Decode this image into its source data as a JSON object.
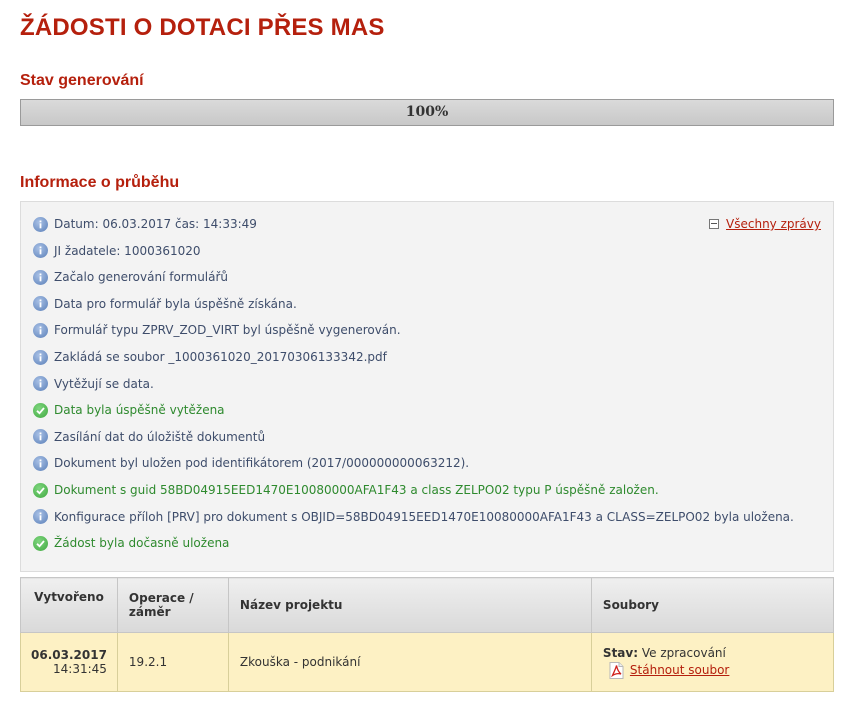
{
  "page_title": "ŽÁDOSTI O DOTACI PŘES MAS",
  "progress": {
    "heading": "Stav generování",
    "label": "100%",
    "value": 1.0
  },
  "log": {
    "heading": "Informace o průběhu",
    "all_messages_label": "Všechny zprávy",
    "entries": [
      {
        "type": "info",
        "icon": "info-icon",
        "text": "Datum: 06.03.2017 čas: 14:33:49"
      },
      {
        "type": "info",
        "icon": "info-icon",
        "text": "JI žadatele: 1000361020"
      },
      {
        "type": "info",
        "icon": "info-icon",
        "text": "Začalo generování formulářů"
      },
      {
        "type": "info",
        "icon": "info-icon",
        "text": "Data pro formulář byla úspěšně získána."
      },
      {
        "type": "info",
        "icon": "info-icon",
        "text": "Formulář typu ZPRV_ZOD_VIRT byl úspěšně vygenerován."
      },
      {
        "type": "info",
        "icon": "info-icon",
        "text": "Zakládá se soubor _1000361020_20170306133342.pdf"
      },
      {
        "type": "info",
        "icon": "info-icon",
        "text": "Vytěžují se data."
      },
      {
        "type": "ok",
        "icon": "check-icon",
        "text": "Data byla úspěšně vytěžena"
      },
      {
        "type": "info",
        "icon": "info-icon",
        "text": "Zasílání dat do úložiště dokumentů"
      },
      {
        "type": "info",
        "icon": "info-icon",
        "text": "Dokument byl uložen pod identifikátorem (2017/000000000063212)."
      },
      {
        "type": "ok",
        "icon": "check-icon",
        "text": "Dokument s guid 58BD04915EED1470E10080000AFA1F43 a class ZELPO02 typu P úspěšně založen."
      },
      {
        "type": "info",
        "icon": "info-icon",
        "text": "Konfigurace příloh [PRV] pro dokument s OBJID=58BD04915EED1470E10080000AFA1F43 a CLASS=ZELPO02 byla uložena."
      },
      {
        "type": "ok",
        "icon": "check-icon",
        "text": "Žádost byla dočasně uložena"
      }
    ]
  },
  "table": {
    "headers": {
      "created": "Vytvořeno",
      "operation_line1": "Operace /",
      "operation_line2": "záměr",
      "project": "Název projektu",
      "files": "Soubory"
    },
    "rows": [
      {
        "date": "06.03.2017",
        "time": "14:31:45",
        "operation": "19.2.1",
        "project": "Zkouška - podnikání",
        "status_label": "Stav:",
        "status_value": "Ve zpracování",
        "download_label": "Stáhnout soubor",
        "file_icon": "pdf-icon"
      }
    ]
  },
  "colors": {
    "heading": "#b5200d",
    "info_text": "#3e4d6b",
    "ok_text": "#2e8a2e",
    "info_icon": "#5a7fb8",
    "ok_icon": "#3fa83f",
    "row_highlight": "#fdf1c4"
  }
}
